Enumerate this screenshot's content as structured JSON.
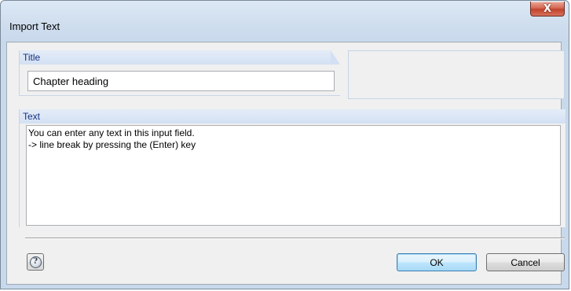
{
  "window": {
    "title": "Import Text",
    "close_glyph": "X"
  },
  "title_group": {
    "label": "Title",
    "input_value": "Chapter heading"
  },
  "text_group": {
    "label": "Text",
    "lines": [
      "You can enter any text in this input field.",
      "-> line break by pressing the (Enter) key"
    ]
  },
  "buttons": {
    "help_icon": "help-icon",
    "ok_label": "OK",
    "cancel_label": "Cancel"
  },
  "colors": {
    "header_text": "#15317e",
    "close_button": "#c0432c",
    "default_button_border": "#3c7fb1"
  }
}
